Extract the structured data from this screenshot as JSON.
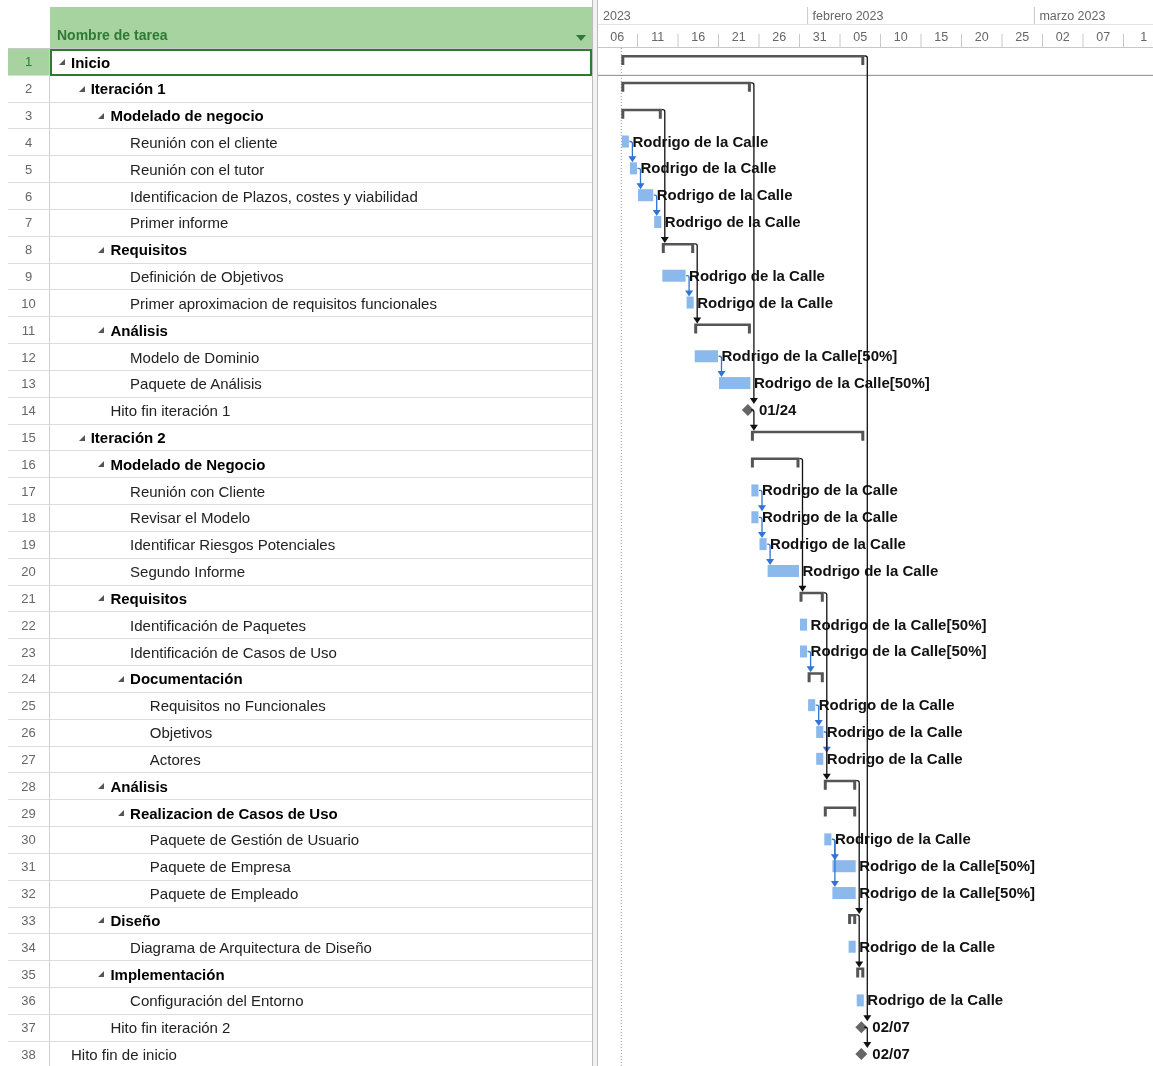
{
  "column_header": "Nombre de tarea",
  "timescale": {
    "months": [
      "2023",
      "febrero 2023",
      "marzo 2023"
    ],
    "days": [
      "06",
      "11",
      "16",
      "21",
      "26",
      "31",
      "05",
      "10",
      "15",
      "20",
      "25",
      "02",
      "07",
      "1"
    ]
  },
  "tasks": [
    {
      "id": "1",
      "name": "Inicio",
      "kind": "summary",
      "expanded": true,
      "selected": true,
      "children": [
        {
          "id": "2",
          "name": "Iteración 1",
          "kind": "summary",
          "expanded": true,
          "selected": false,
          "children": [
            {
              "id": "3",
              "name": "Modelado de negocio",
              "kind": "summary",
              "expanded": true,
              "selected": false,
              "children": [
                {
                  "id": "4",
                  "name": "Reunión con el cliente",
                  "kind": "task",
                  "selected": false,
                  "label": "Rodrigo de la Calle"
                },
                {
                  "id": "5",
                  "name": "Reunión con el tutor",
                  "kind": "task",
                  "selected": false,
                  "label": "Rodrigo de la Calle"
                },
                {
                  "id": "6",
                  "name": "Identificacion de Plazos, costes y viabilidad",
                  "kind": "task",
                  "selected": false,
                  "label": "Rodrigo de la Calle"
                },
                {
                  "id": "7",
                  "name": "Primer informe",
                  "kind": "task",
                  "selected": false,
                  "label": "Rodrigo de la Calle"
                }
              ]
            },
            {
              "id": "8",
              "name": "Requisitos",
              "kind": "summary",
              "expanded": true,
              "selected": false,
              "children": [
                {
                  "id": "9",
                  "name": "Definición de Objetivos",
                  "kind": "task",
                  "selected": false,
                  "label": "Rodrigo de la Calle"
                },
                {
                  "id": "10",
                  "name": "Primer aproximacion de requisitos funcionales",
                  "kind": "task",
                  "selected": false,
                  "label": "Rodrigo de la Calle"
                }
              ]
            },
            {
              "id": "11",
              "name": "Análisis",
              "kind": "summary",
              "expanded": true,
              "selected": false,
              "children": [
                {
                  "id": "12",
                  "name": "Modelo de Dominio",
                  "kind": "task",
                  "selected": false,
                  "label": "Rodrigo de la Calle[50%]"
                },
                {
                  "id": "13",
                  "name": "Paquete de Análisis",
                  "kind": "task",
                  "selected": false,
                  "label": "Rodrigo de la Calle[50%]"
                }
              ]
            },
            {
              "id": "14",
              "name": "Hito fin iteración 1",
              "kind": "milestone",
              "selected": false,
              "label": "01/24"
            }
          ]
        },
        {
          "id": "15",
          "name": "Iteración 2",
          "kind": "summary",
          "expanded": true,
          "selected": false,
          "children": [
            {
              "id": "16",
              "name": "Modelado de Negocio",
              "kind": "summary",
              "expanded": true,
              "selected": false,
              "children": [
                {
                  "id": "17",
                  "name": "Reunión con Cliente",
                  "kind": "task",
                  "selected": false,
                  "label": "Rodrigo de la Calle"
                },
                {
                  "id": "18",
                  "name": "Revisar el Modelo",
                  "kind": "task",
                  "selected": false,
                  "label": "Rodrigo de la Calle"
                },
                {
                  "id": "19",
                  "name": "Identificar Riesgos Potenciales",
                  "kind": "task",
                  "selected": false,
                  "label": "Rodrigo de la Calle"
                },
                {
                  "id": "20",
                  "name": "Segundo Informe",
                  "kind": "task",
                  "selected": false,
                  "label": "Rodrigo de la Calle"
                }
              ]
            },
            {
              "id": "21",
              "name": "Requisitos",
              "kind": "summary",
              "expanded": true,
              "selected": false,
              "children": [
                {
                  "id": "22",
                  "name": "Identificación de Paquetes",
                  "kind": "task",
                  "selected": false,
                  "label": "Rodrigo de la Calle[50%]"
                },
                {
                  "id": "23",
                  "name": "Identificación de Casos de Uso",
                  "kind": "task",
                  "selected": false,
                  "label": "Rodrigo de la Calle[50%]"
                },
                {
                  "id": "24",
                  "name": "Documentación",
                  "kind": "summary",
                  "expanded": true,
                  "selected": false,
                  "children": [
                    {
                      "id": "25",
                      "name": "Requisitos no Funcionales",
                      "kind": "task",
                      "selected": false,
                      "label": "Rodrigo de la Calle"
                    },
                    {
                      "id": "26",
                      "name": "Objetivos",
                      "kind": "task",
                      "selected": false,
                      "label": "Rodrigo de la Calle"
                    },
                    {
                      "id": "27",
                      "name": "Actores",
                      "kind": "task",
                      "selected": false,
                      "label": "Rodrigo de la Calle"
                    }
                  ]
                }
              ]
            },
            {
              "id": "28",
              "name": "Análisis",
              "kind": "summary",
              "expanded": true,
              "selected": false,
              "children": [
                {
                  "id": "29",
                  "name": "Realizacion de Casos de Uso",
                  "kind": "summary",
                  "expanded": true,
                  "selected": false,
                  "children": [
                    {
                      "id": "30",
                      "name": "Paquete de Gestión de Usuario",
                      "kind": "task",
                      "selected": false,
                      "label": "Rodrigo de la Calle"
                    },
                    {
                      "id": "31",
                      "name": "Paquete de Empresa",
                      "kind": "task",
                      "selected": false,
                      "label": "Rodrigo de la Calle[50%]"
                    },
                    {
                      "id": "32",
                      "name": "Paquete de Empleado",
                      "kind": "task",
                      "selected": false,
                      "label": "Rodrigo de la Calle[50%]"
                    }
                  ]
                }
              ]
            },
            {
              "id": "33",
              "name": "Diseño",
              "kind": "summary",
              "expanded": true,
              "selected": false,
              "children": [
                {
                  "id": "34",
                  "name": "Diagrama de Arquitectura de Diseño",
                  "kind": "task",
                  "selected": false,
                  "label": "Rodrigo de la Calle"
                }
              ]
            },
            {
              "id": "35",
              "name": "Implementación",
              "kind": "summary",
              "expanded": true,
              "selected": false,
              "children": [
                {
                  "id": "36",
                  "name": "Configuración del Entorno",
                  "kind": "task",
                  "selected": false,
                  "label": "Rodrigo de la Calle"
                }
              ]
            },
            {
              "id": "37",
              "name": "Hito fin iteración 2",
              "kind": "milestone",
              "selected": false,
              "label": "02/07"
            }
          ]
        }
      ]
    },
    {
      "id": "38",
      "name": "Hito fin de inicio",
      "kind": "milestone",
      "selected": false,
      "label": "02/07"
    }
  ]
}
